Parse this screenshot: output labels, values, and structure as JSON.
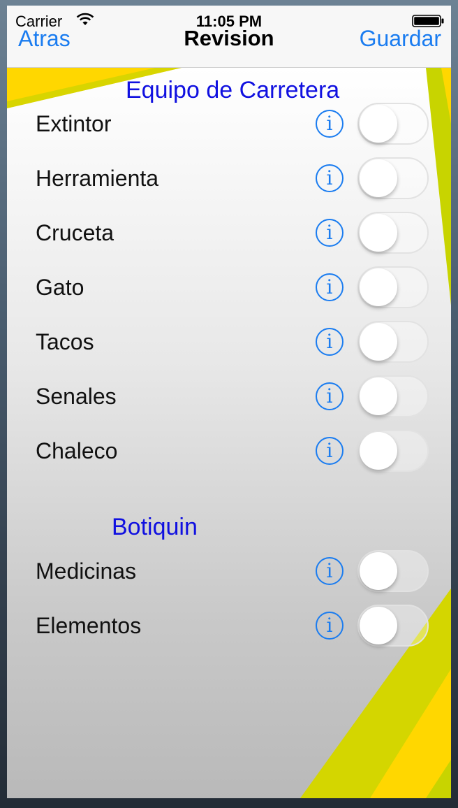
{
  "status_bar": {
    "carrier": "Carrier",
    "time": "11:05 PM"
  },
  "nav": {
    "back_label": "Atras",
    "title": "Revision",
    "save_label": "Guardar"
  },
  "colors": {
    "accent": "#1a7cf0",
    "section_title": "#1010e0",
    "deco_yellow": "#ffd700",
    "deco_lime": "#c8d400"
  },
  "icons": {
    "wifi": "wifi-icon",
    "battery": "battery-icon",
    "info": "info-icon"
  },
  "sections": [
    {
      "title": "Equipo de Carretera",
      "items": [
        {
          "label": "Extintor",
          "info": "i",
          "on": false
        },
        {
          "label": "Herramienta",
          "info": "i",
          "on": false
        },
        {
          "label": "Cruceta",
          "info": "i",
          "on": false
        },
        {
          "label": "Gato",
          "info": "i",
          "on": false
        },
        {
          "label": "Tacos",
          "info": "i",
          "on": false
        },
        {
          "label": "Senales",
          "info": "i",
          "on": false
        },
        {
          "label": "Chaleco",
          "info": "i",
          "on": false
        }
      ]
    },
    {
      "title": "Botiquin",
      "items": [
        {
          "label": "Medicinas",
          "info": "i",
          "on": false
        },
        {
          "label": "Elementos",
          "info": "i",
          "on": false
        }
      ]
    }
  ]
}
